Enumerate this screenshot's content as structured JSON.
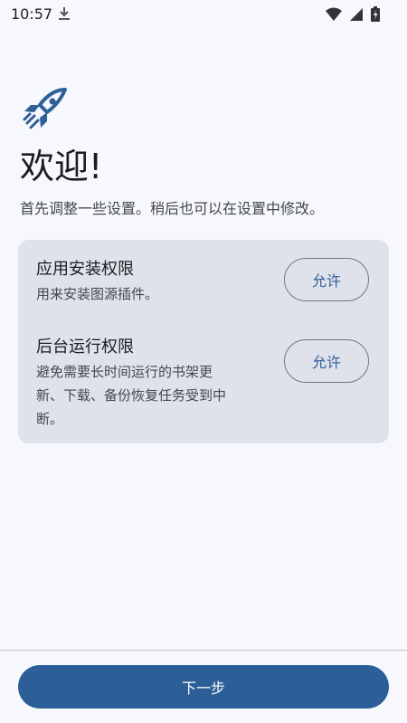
{
  "status_bar": {
    "time": "10:57",
    "icons": [
      "download-icon",
      "wifi-icon",
      "cell-signal-icon",
      "battery-icon"
    ]
  },
  "onboarding": {
    "hero_icon": "rocket-icon",
    "title": "欢迎!",
    "subtitle": "首先调整一些设置。稍后也可以在设置中修改。"
  },
  "permissions": {
    "install": {
      "title": "应用安装权限",
      "description": "用来安装图源插件。",
      "button_label": "允许"
    },
    "background": {
      "title": "后台运行权限",
      "description_lines": [
        "避免需要长时间运行的书架更",
        "新、下载、备份恢复任务受到中",
        "断。"
      ],
      "button_label": "允许"
    }
  },
  "footer": {
    "next_label": "下一步"
  },
  "colors": {
    "background": "#f6f8fd",
    "card": "#dfe2eb",
    "accent": "#2c5f97",
    "outline": "#74777f"
  }
}
